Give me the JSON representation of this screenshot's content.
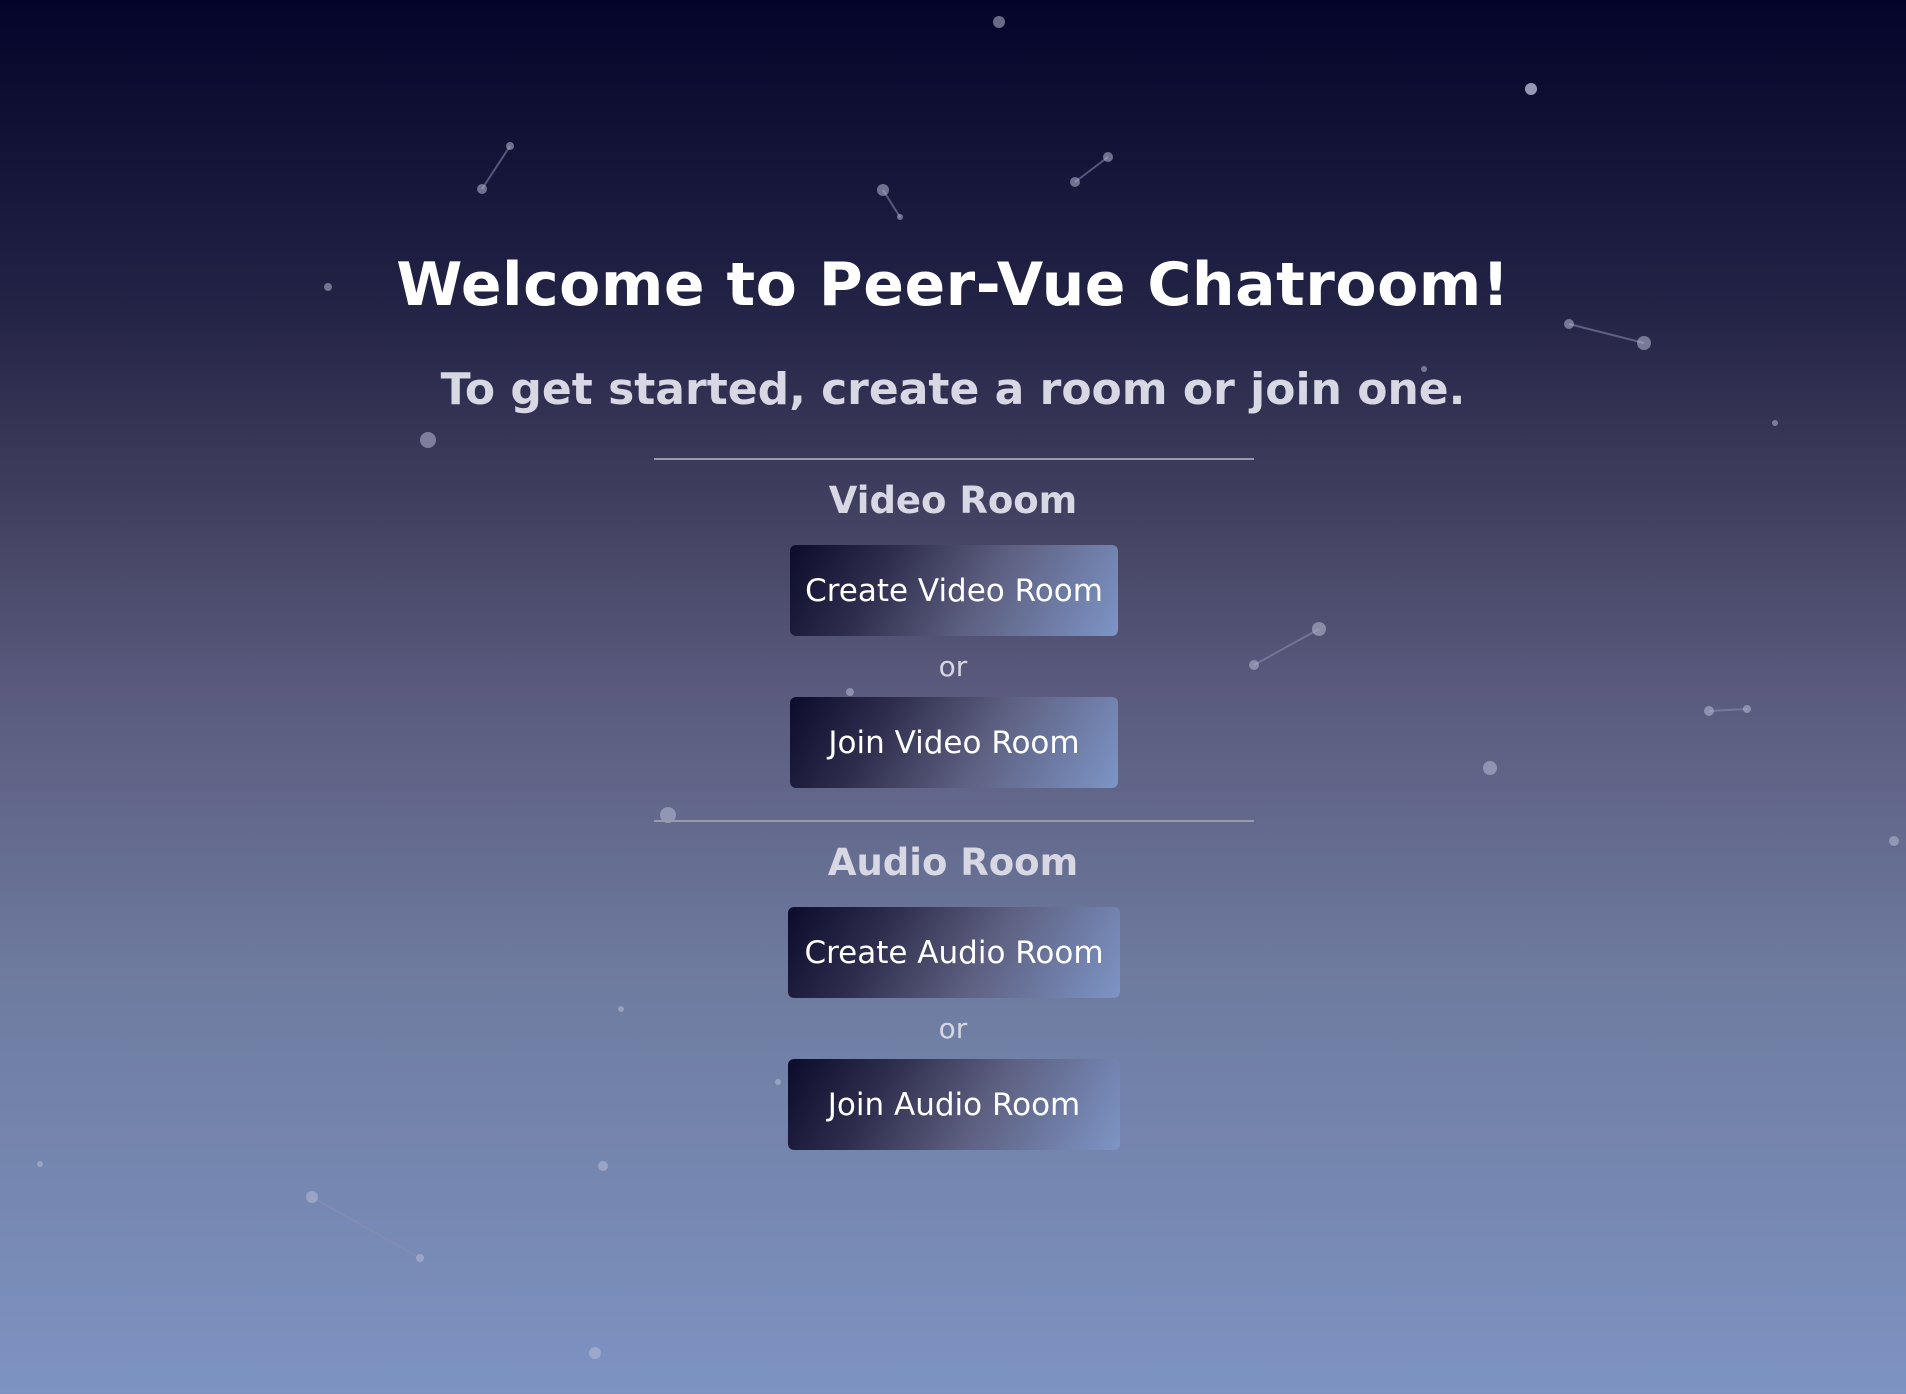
{
  "header": {
    "title": "Welcome to Peer-Vue Chatroom!",
    "subtitle": "To get started, create a room or join one."
  },
  "video_section": {
    "heading": "Video Room",
    "create_label": "Create Video Room",
    "or_label": "or",
    "join_label": "Join Video Room"
  },
  "audio_section": {
    "heading": "Audio Room",
    "create_label": "Create Audio Room",
    "or_label": "or",
    "join_label": "Join Audio Room"
  },
  "colors": {
    "background_top": "#04042a",
    "background_bottom": "#7d93c2",
    "button_dark": "#0b0b2c",
    "button_light": "#7d95c6",
    "text_primary": "#ffffff",
    "text_secondary": "#d8d7e4"
  }
}
